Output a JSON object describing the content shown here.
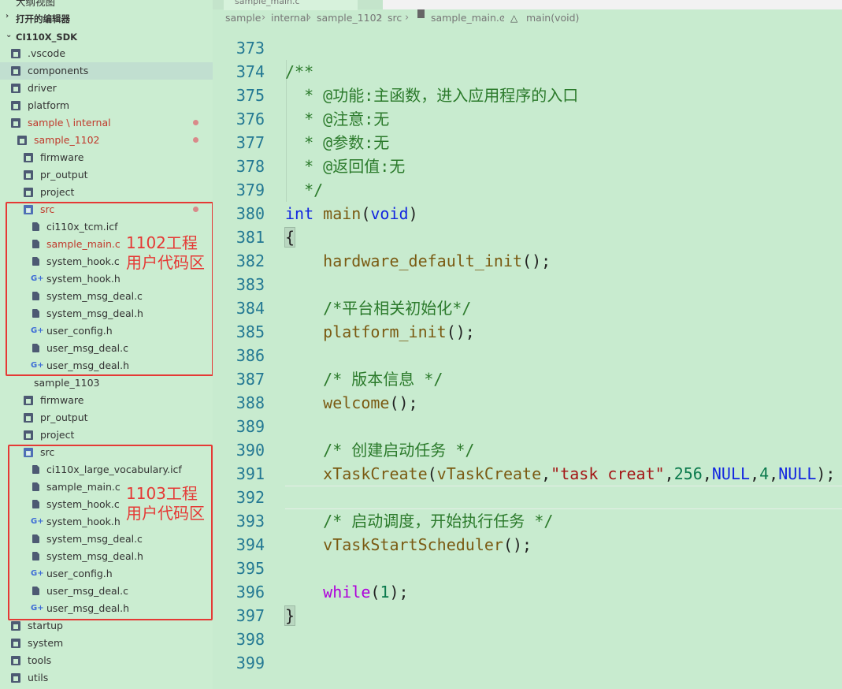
{
  "sidebar": {
    "hidden_header": "大纲视图",
    "open_editors": "打开的编辑器",
    "root": "CI110X_SDK",
    "items": [
      {
        "label": ".vscode",
        "type": "folder-vscode",
        "indent": 1
      },
      {
        "label": "components",
        "type": "folder",
        "indent": 1,
        "selected": true
      },
      {
        "label": "driver",
        "type": "folder",
        "indent": 1
      },
      {
        "label": "platform",
        "type": "folder",
        "indent": 1
      },
      {
        "label": "sample",
        "label2": "internal",
        "type": "folder",
        "indent": 1,
        "modified": true,
        "red": true
      },
      {
        "label": "sample_1102",
        "type": "folder",
        "indent": 2,
        "modified": true,
        "red": true
      },
      {
        "label": "firmware",
        "type": "folder",
        "indent": 3
      },
      {
        "label": "pr_output",
        "type": "folder",
        "indent": 3
      },
      {
        "label": "project",
        "type": "folder",
        "indent": 3
      },
      {
        "label": "src",
        "type": "folder-src",
        "indent": 3,
        "modified": true,
        "red": true
      },
      {
        "label": "ci110x_tcm.icf",
        "type": "file",
        "indent": 4
      },
      {
        "label": "sample_main.c",
        "type": "file",
        "indent": 4,
        "red": true
      },
      {
        "label": "system_hook.c",
        "type": "file",
        "indent": 4
      },
      {
        "label": "system_hook.h",
        "type": "header",
        "indent": 4
      },
      {
        "label": "system_msg_deal.c",
        "type": "file",
        "indent": 4
      },
      {
        "label": "system_msg_deal.h",
        "type": "file",
        "indent": 4
      },
      {
        "label": "user_config.h",
        "type": "header",
        "indent": 4
      },
      {
        "label": "user_msg_deal.c",
        "type": "file",
        "indent": 4
      },
      {
        "label": "user_msg_deal.h",
        "type": "header",
        "indent": 4
      },
      {
        "label": "sample_1103",
        "type": "none",
        "indent": 2
      },
      {
        "label": "firmware",
        "type": "folder",
        "indent": 3
      },
      {
        "label": "pr_output",
        "type": "folder",
        "indent": 3
      },
      {
        "label": "project",
        "type": "folder",
        "indent": 3
      },
      {
        "label": "src",
        "type": "folder-src",
        "indent": 3
      },
      {
        "label": "ci110x_large_vocabulary.icf",
        "type": "file",
        "indent": 4
      },
      {
        "label": "sample_main.c",
        "type": "file",
        "indent": 4
      },
      {
        "label": "system_hook.c",
        "type": "file",
        "indent": 4
      },
      {
        "label": "system_hook.h",
        "type": "header",
        "indent": 4
      },
      {
        "label": "system_msg_deal.c",
        "type": "file",
        "indent": 4
      },
      {
        "label": "system_msg_deal.h",
        "type": "file",
        "indent": 4
      },
      {
        "label": "user_config.h",
        "type": "header",
        "indent": 4
      },
      {
        "label": "user_msg_deal.c",
        "type": "file",
        "indent": 4
      },
      {
        "label": "user_msg_deal.h",
        "type": "header",
        "indent": 4
      },
      {
        "label": "startup",
        "type": "folder",
        "indent": 1
      },
      {
        "label": "system",
        "type": "folder",
        "indent": 1
      },
      {
        "label": "tools",
        "type": "folder",
        "indent": 1
      },
      {
        "label": "utils",
        "type": "folder",
        "indent": 1
      }
    ],
    "annotations": [
      {
        "line1": "1102工程",
        "line2": "用户代码区"
      },
      {
        "line1": "1103工程",
        "line2": "用户代码区"
      }
    ]
  },
  "editor": {
    "tab_label": "sample_main.c",
    "breadcrumb": [
      "sample",
      "internal",
      "sample_1102",
      "src",
      "sample_main.c",
      "main(void)"
    ],
    "current_line": 392,
    "lines": [
      {
        "n": 373,
        "t": []
      },
      {
        "n": 374,
        "t": [
          [
            "cm",
            "/**"
          ]
        ]
      },
      {
        "n": 375,
        "t": [
          [
            "cm",
            "  * @功能:主函数，进入应用程序的入口"
          ]
        ]
      },
      {
        "n": 376,
        "t": [
          [
            "cm",
            "  * @注意:无"
          ]
        ]
      },
      {
        "n": 377,
        "t": [
          [
            "cm",
            "  * @参数:无"
          ]
        ]
      },
      {
        "n": 378,
        "t": [
          [
            "cm",
            "  * @返回值:无"
          ]
        ]
      },
      {
        "n": 379,
        "t": [
          [
            "cm",
            "  */"
          ]
        ]
      },
      {
        "n": 380,
        "t": [
          [
            "kw",
            "int"
          ],
          [
            "",
            " "
          ],
          [
            "fn",
            "main"
          ],
          [
            "",
            "("
          ],
          [
            "kw",
            "void"
          ],
          [
            "",
            ")"
          ]
        ]
      },
      {
        "n": 381,
        "t": [
          [
            "brk",
            "{"
          ]
        ]
      },
      {
        "n": 382,
        "t": [
          [
            "",
            "    "
          ],
          [
            "fn",
            "hardware_default_init"
          ],
          [
            "",
            "();"
          ]
        ]
      },
      {
        "n": 383,
        "t": []
      },
      {
        "n": 384,
        "t": [
          [
            "",
            "    "
          ],
          [
            "cm",
            "/*平台相关初始化*/"
          ]
        ]
      },
      {
        "n": 385,
        "t": [
          [
            "",
            "    "
          ],
          [
            "fn",
            "platform_init"
          ],
          [
            "",
            "();"
          ]
        ]
      },
      {
        "n": 386,
        "t": []
      },
      {
        "n": 387,
        "t": [
          [
            "",
            "    "
          ],
          [
            "cm",
            "/* 版本信息 */"
          ]
        ]
      },
      {
        "n": 388,
        "t": [
          [
            "",
            "    "
          ],
          [
            "fn",
            "welcome"
          ],
          [
            "",
            "();"
          ]
        ]
      },
      {
        "n": 389,
        "t": []
      },
      {
        "n": 390,
        "t": [
          [
            "",
            "    "
          ],
          [
            "cm",
            "/* 创建启动任务 */"
          ]
        ]
      },
      {
        "n": 391,
        "t": [
          [
            "",
            "    "
          ],
          [
            "fn",
            "xTaskCreate"
          ],
          [
            "",
            "("
          ],
          [
            "fn",
            "vTaskCreate"
          ],
          [
            "",
            ","
          ],
          [
            "str",
            "\"task creat\""
          ],
          [
            "",
            ","
          ],
          [
            "num",
            "256"
          ],
          [
            "",
            ","
          ],
          [
            "kw",
            "NULL"
          ],
          [
            "",
            ","
          ],
          [
            "num",
            "4"
          ],
          [
            "",
            ","
          ],
          [
            "kw",
            "NULL"
          ],
          [
            "",
            ");"
          ]
        ]
      },
      {
        "n": 392,
        "t": []
      },
      {
        "n": 393,
        "t": [
          [
            "",
            "    "
          ],
          [
            "cm",
            "/* 启动调度，开始执行任务 */"
          ]
        ]
      },
      {
        "n": 394,
        "t": [
          [
            "",
            "    "
          ],
          [
            "fn",
            "vTaskStartScheduler"
          ],
          [
            "",
            "();"
          ]
        ]
      },
      {
        "n": 395,
        "t": []
      },
      {
        "n": 396,
        "t": [
          [
            "",
            "    "
          ],
          [
            "ctl",
            "while"
          ],
          [
            "",
            "("
          ],
          [
            "num",
            "1"
          ],
          [
            "",
            ");"
          ]
        ]
      },
      {
        "n": 397,
        "t": [
          [
            "brk",
            "}"
          ]
        ]
      },
      {
        "n": 398,
        "t": []
      },
      {
        "n": 399,
        "t": []
      }
    ]
  },
  "colors": {
    "sidebar_bg": "#cbedd1",
    "editor_bg": "#c8ebcf",
    "annotation_red": "#e53935",
    "line_number": "#237893"
  }
}
